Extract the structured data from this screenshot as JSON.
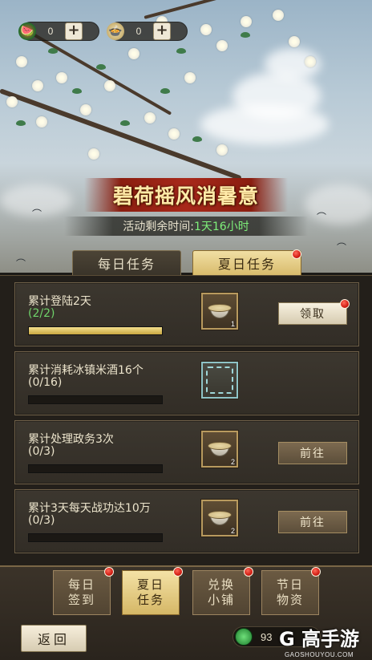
{
  "resources": [
    {
      "icon": "watermelon-icon",
      "value": "0",
      "plus": "+"
    },
    {
      "icon": "rice-bowl-icon",
      "value": "0",
      "plus": "+"
    }
  ],
  "event": {
    "title": "碧荷摇风消暑意",
    "timer_label": "活动剩余时间:",
    "timer_value": "1天16小时"
  },
  "tabs": [
    {
      "label": "每日任务",
      "active": false
    },
    {
      "label": "夏日任务",
      "active": true
    }
  ],
  "tasks": [
    {
      "title": "累计登陆2天",
      "progress": "(2/2)",
      "progress_fraction": 1.0,
      "reward_count": "1",
      "button": "领取"
    },
    {
      "title": "累计消耗冰镇米酒16个",
      "progress": "(0/16)",
      "progress_fraction": 0,
      "reward_count": "",
      "button": ""
    },
    {
      "title": "累计处理政务3次",
      "progress": "(0/3)",
      "progress_fraction": 0,
      "reward_count": "2",
      "button": "前往"
    },
    {
      "title": "累计3天每天战功达10万",
      "progress": "(0/3)",
      "progress_fraction": 0,
      "reward_count": "2",
      "button": "前往"
    }
  ],
  "bottom_nav": [
    {
      "line1": "每日",
      "line2": "签到",
      "active": false
    },
    {
      "line1": "夏日",
      "line2": "任务",
      "active": true
    },
    {
      "line1": "兑换",
      "line2": "小铺",
      "active": false
    },
    {
      "line1": "节日",
      "line2": "物资",
      "active": false
    }
  ],
  "back_label": "返回",
  "currency": {
    "icon": "jade-coin-icon",
    "value": "93"
  },
  "watermark": {
    "main": "G 高手游",
    "sub": "GAOSHOUYOU.COM"
  },
  "colors": {
    "accent_gold": "#d8bb6c",
    "progress_green": "#6fd36a",
    "timer_green": "#7ef07a",
    "title_red": "#a8281a",
    "notification_red": "#d21f14"
  }
}
